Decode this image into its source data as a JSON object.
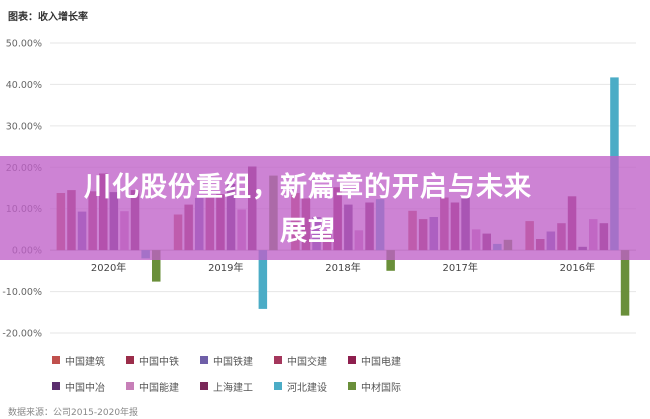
{
  "chart_data": {
    "type": "bar",
    "title": "图表：收入增长率",
    "source": "数据来源：公司2015-2020年报",
    "categories": [
      "2020年",
      "2019年",
      "2018年",
      "2017年",
      "2016年"
    ],
    "ylim": [
      -20,
      50
    ],
    "yticks": [
      "50.00%",
      "40.00%",
      "30.00%",
      "20.00%",
      "10.00%",
      "0.00%",
      "-10.00%",
      "-20.00%"
    ],
    "ytick_values": [
      50,
      40,
      30,
      20,
      10,
      0,
      -10,
      -20
    ],
    "series": [
      {
        "name": "中国建筑",
        "color": "#c0504d",
        "values": [
          13.8,
          8.6,
          13.8,
          9.5,
          7.0
        ]
      },
      {
        "name": "中国中铁",
        "color": "#9b2d4a",
        "values": [
          14.5,
          11.0,
          12.5,
          7.5,
          2.7
        ]
      },
      {
        "name": "中国铁建",
        "color": "#6f5fa8",
        "values": [
          9.3,
          12.6,
          8.0,
          8.0,
          4.5
        ]
      },
      {
        "name": "中国交建",
        "color": "#a4375c",
        "values": [
          14.2,
          13.0,
          4.6,
          12.7,
          6.5
        ]
      },
      {
        "name": "中国电建",
        "color": "#8e1f4e",
        "values": [
          18.5,
          13.5,
          15.2,
          11.5,
          13.0
        ]
      },
      {
        "name": "中国中冶",
        "color": "#5b2e6e",
        "values": [
          14.0,
          16.0,
          11.0,
          13.0,
          0.8
        ]
      },
      {
        "name": "中国能建",
        "color": "#c77fb8",
        "values": [
          9.4,
          9.8,
          4.8,
          5.0,
          7.5
        ]
      },
      {
        "name": "上海建工",
        "color": "#7a2859",
        "values": [
          14.5,
          20.2,
          11.5,
          4.0,
          6.5
        ]
      },
      {
        "name": "河北建设",
        "color": "#4bacc6",
        "values": [
          -2.0,
          -14.2,
          12.3,
          1.5,
          41.7
        ]
      },
      {
        "name": "中材国际",
        "color": "#6a8f3a",
        "values": [
          -7.6,
          18.0,
          -5.0,
          2.5,
          -15.8
        ]
      }
    ]
  },
  "banner": {
    "line1": "川化股份重组，新篇章的开启与未来",
    "line2": "展望"
  }
}
